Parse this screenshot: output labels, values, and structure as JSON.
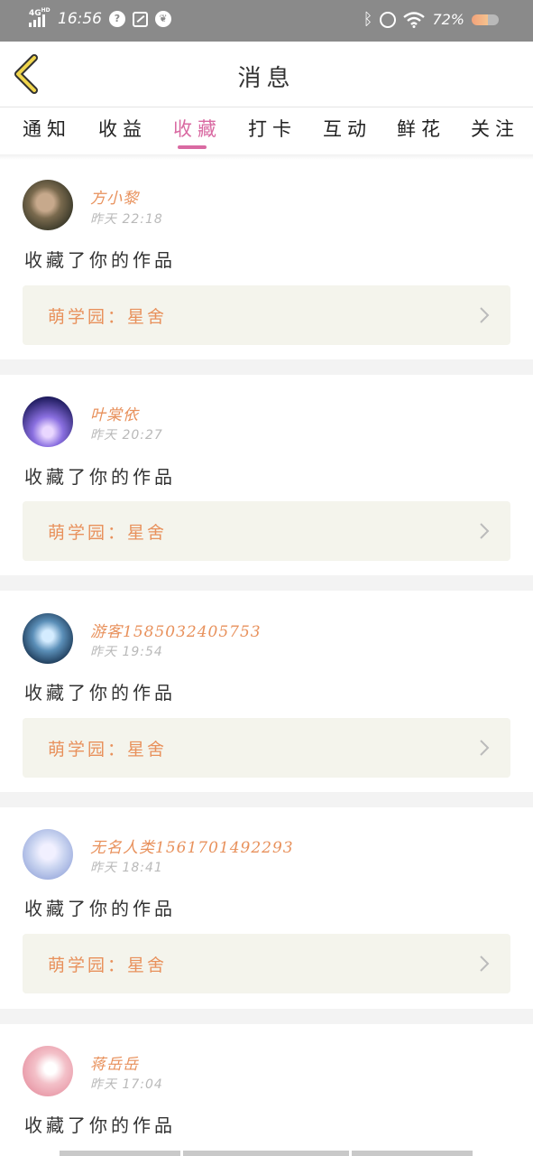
{
  "status_bar": {
    "network": "4G",
    "network_sup": "HD",
    "time": "16:56",
    "battery_percent": "72%",
    "icons": [
      "signal-icon",
      "question-circle-icon",
      "screenshot-off-icon",
      "leaf-icon",
      "bluetooth-icon",
      "alarm-icon",
      "wifi-icon",
      "battery-icon"
    ]
  },
  "header": {
    "back_icon": "chevron-left-icon",
    "title": "消息"
  },
  "tabs": [
    {
      "label": "通知",
      "active": false
    },
    {
      "label": "收益",
      "active": false
    },
    {
      "label": "收藏",
      "active": true
    },
    {
      "label": "打卡",
      "active": false
    },
    {
      "label": "互动",
      "active": false
    },
    {
      "label": "鲜花",
      "active": false
    },
    {
      "label": "关注",
      "active": false
    }
  ],
  "messages": [
    {
      "name": "方小黎",
      "time": "昨天 22:18",
      "action": "收藏了你的作品",
      "work": "萌学园：星舍",
      "avatar_colors": [
        "#3b3a2a",
        "#c7a98c",
        "#7a6a4e"
      ]
    },
    {
      "name": "叶棠依",
      "time": "昨天 20:27",
      "action": "收藏了你的作品",
      "work": "萌学园：星舍",
      "avatar_colors": [
        "#1d1a5c",
        "#8a6fe0",
        "#e9d7ff"
      ]
    },
    {
      "name": "游客1585032405753",
      "time": "昨天 19:54",
      "action": "收藏了你的作品",
      "work": "萌学园：星舍",
      "avatar_colors": [
        "#0e2540",
        "#5b8fb8",
        "#d4ecff"
      ]
    },
    {
      "name": "无名人类1561701492293",
      "time": "昨天 18:41",
      "action": "收藏了你的作品",
      "work": "萌学园：星舍",
      "avatar_colors": [
        "#c9d4f0",
        "#8fa0d8",
        "#f1f0ff"
      ]
    },
    {
      "name": "蒋岳岳",
      "time": "昨天 17:04",
      "action": "收藏了你的作品",
      "work": "",
      "avatar_colors": [
        "#f3c0c8",
        "#e48a9b",
        "#ffffff"
      ]
    }
  ],
  "colors": {
    "accent_pink": "#d96aa2",
    "name_orange": "#e8915c",
    "back_chevron_yellow": "#f0d54c",
    "card_box_bg": "#f4f4ec"
  }
}
